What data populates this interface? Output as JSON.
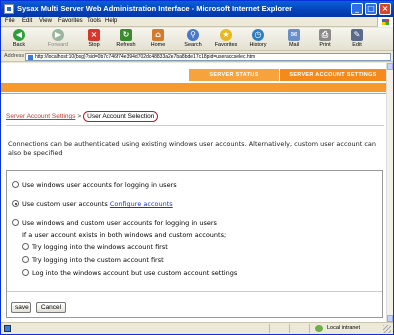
{
  "window": {
    "title": "Sysax Multi Server Web Administration Interface - Microsoft Internet Explorer"
  },
  "menu": [
    "File",
    "Edit",
    "View",
    "Favorites",
    "Tools",
    "Help"
  ],
  "toolbar": {
    "back": "Back",
    "forward": "Forward",
    "stop": "Stop",
    "refresh": "Refresh",
    "home": "Home",
    "search": "Search",
    "favorites": "Favorites",
    "history": "History",
    "mail": "Mail",
    "print": "Print",
    "edit": "Edit"
  },
  "address": {
    "label": "Address",
    "url": "http://localhost:10(bsg)?sid=0b7c746f74e394d702dc48833a2e7ba8bde17c18pid=useraccselec.htm"
  },
  "nav": {
    "server_status": "SERVER STATUS",
    "server_account_settings": "SERVER ACCOUNT SETTINGS"
  },
  "breadcrumb": {
    "parent": "Server Account Settings",
    "separator": ">",
    "current": "User Account Selection"
  },
  "intro": "Connections can be authenticated using existing windows user accounts. Alternatively, custom user account can also be specified",
  "options": {
    "windows_only": "Use windows user accounts for logging in users",
    "custom_only": "Use custom user accounts",
    "configure_link": "Configure accounts",
    "both": "Use windows and custom user accounts for logging in users",
    "conflict_note": "If a user account exists in both windows and custom accounts;",
    "sub_windows_first": "Try logging into the windows account first",
    "sub_custom_first": "Try logging into the custom account first",
    "sub_windows_custom_settings": "Log into the windows account but use custom account settings",
    "selected": "custom_only"
  },
  "buttons": {
    "save": "save",
    "cancel": "Cancel"
  },
  "status": {
    "zone": "Local intranet"
  },
  "colors": {
    "accent_orange": "#f79a2d",
    "link_blue": "#1a35c8",
    "crumb_red": "#c0182b"
  }
}
